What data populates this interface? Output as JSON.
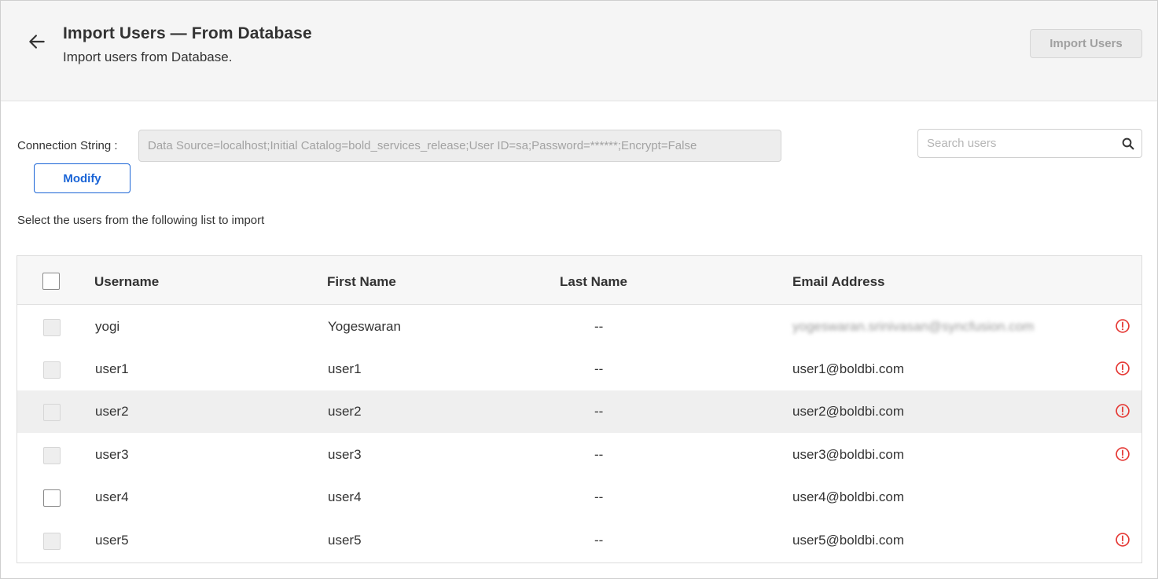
{
  "header": {
    "title": "Import Users — From Database",
    "subtitle": "Import users from Database.",
    "import_button": "Import Users"
  },
  "connection": {
    "label": "Connection String :",
    "value": "Data Source=localhost;Initial Catalog=bold_services_release;User ID=sa;Password=******;Encrypt=False",
    "modify_button": "Modify"
  },
  "search": {
    "placeholder": "Search users"
  },
  "instruction": "Select the users from the following list to import",
  "table": {
    "columns": [
      "Username",
      "First Name",
      "Last Name",
      "Email Address"
    ],
    "rows": [
      {
        "username": "yogi",
        "first_name": "Yogeswaran",
        "last_name": "--",
        "email": "yogeswaran.srinivasan@syncfusion.com",
        "email_obscured": true,
        "selectable": false,
        "warning": true
      },
      {
        "username": "user1",
        "first_name": "user1",
        "last_name": "--",
        "email": "user1@boldbi.com",
        "selectable": false,
        "warning": true
      },
      {
        "username": "user2",
        "first_name": "user2",
        "last_name": "--",
        "email": "user2@boldbi.com",
        "selectable": false,
        "warning": true,
        "hovered": true
      },
      {
        "username": "user3",
        "first_name": "user3",
        "last_name": "--",
        "email": "user3@boldbi.com",
        "selectable": false,
        "warning": true
      },
      {
        "username": "user4",
        "first_name": "user4",
        "last_name": "--",
        "email": "user4@boldbi.com",
        "selectable": true,
        "warning": false
      },
      {
        "username": "user5",
        "first_name": "user5",
        "last_name": "--",
        "email": "user5@boldbi.com",
        "selectable": false,
        "warning": true
      }
    ]
  },
  "icons": {
    "back": "arrow-left-icon",
    "search": "search-icon",
    "warning": "warning-circle-icon"
  },
  "colors": {
    "accent": "#1a64d6",
    "warning": "#e53935",
    "header_bg": "#f5f5f5",
    "row_hover": "#efefef"
  }
}
